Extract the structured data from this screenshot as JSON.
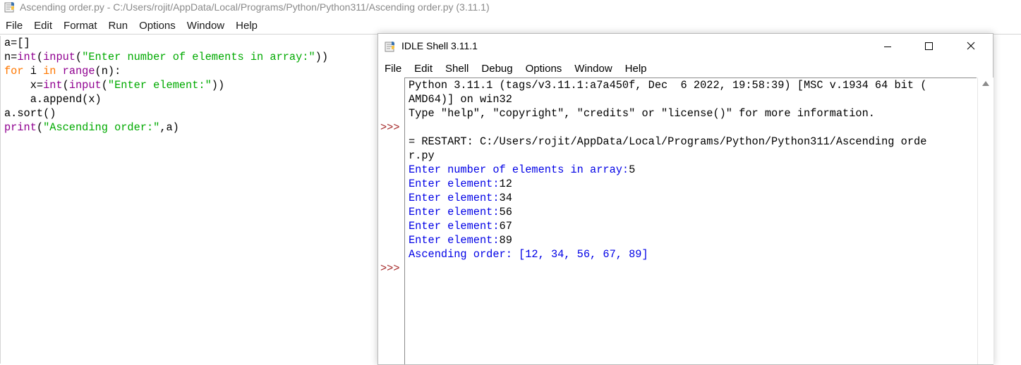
{
  "editor": {
    "title": "Ascending order.py - C:/Users/rojit/AppData/Local/Programs/Python/Python311/Ascending order.py (3.11.1)",
    "menu": [
      "File",
      "Edit",
      "Format",
      "Run",
      "Options",
      "Window",
      "Help"
    ],
    "code": {
      "l1": "a=[]",
      "l2_a": "n=",
      "l2_b": "int",
      "l2_c": "(",
      "l2_d": "input",
      "l2_e": "(",
      "l2_f": "\"Enter number of elements in array:\"",
      "l2_g": "))",
      "l3_a": "for",
      "l3_b": " i ",
      "l3_c": "in",
      "l3_d": " ",
      "l3_e": "range",
      "l3_f": "(n):",
      "l4_a": "    x=",
      "l4_b": "int",
      "l4_c": "(",
      "l4_d": "input",
      "l4_e": "(",
      "l4_f": "\"Enter element:\"",
      "l4_g": "))",
      "l5": "    a.append(x)",
      "l6": "a.sort()",
      "l7_a": "print",
      "l7_b": "(",
      "l7_c": "\"Ascending order:\"",
      "l7_d": ",a)"
    }
  },
  "shell": {
    "title": "IDLE Shell 3.11.1",
    "menu": [
      "File",
      "Edit",
      "Shell",
      "Debug",
      "Options",
      "Window",
      "Help"
    ],
    "prompt": ">>>",
    "lines": {
      "banner1": "Python 3.11.1 (tags/v3.11.1:a7a450f, Dec  6 2022, 19:58:39) [MSC v.1934 64 bit (",
      "banner2": "AMD64)] on win32",
      "banner3": "Type \"help\", \"copyright\", \"credits\" or \"license()\" for more information.",
      "restart1": "= RESTART: C:/Users/rojit/AppData/Local/Programs/Python/Python311/Ascending orde",
      "restart2": "r.py",
      "in1_prompt": "Enter number of elements in array:",
      "in1_val": "5",
      "in2_prompt": "Enter element:",
      "in2_val": "12",
      "in3_prompt": "Enter element:",
      "in3_val": "34",
      "in4_prompt": "Enter element:",
      "in4_val": "56",
      "in5_prompt": "Enter element:",
      "in5_val": "67",
      "in6_prompt": "Enter element:",
      "in6_val": "89",
      "result": "Ascending order: [12, 34, 56, 67, 89]"
    }
  },
  "colors": {
    "keyword": "#ff7700",
    "builtin": "#900090",
    "string": "#00aa00",
    "stdout": "#0000e6",
    "prompt": "#a52a2a"
  }
}
